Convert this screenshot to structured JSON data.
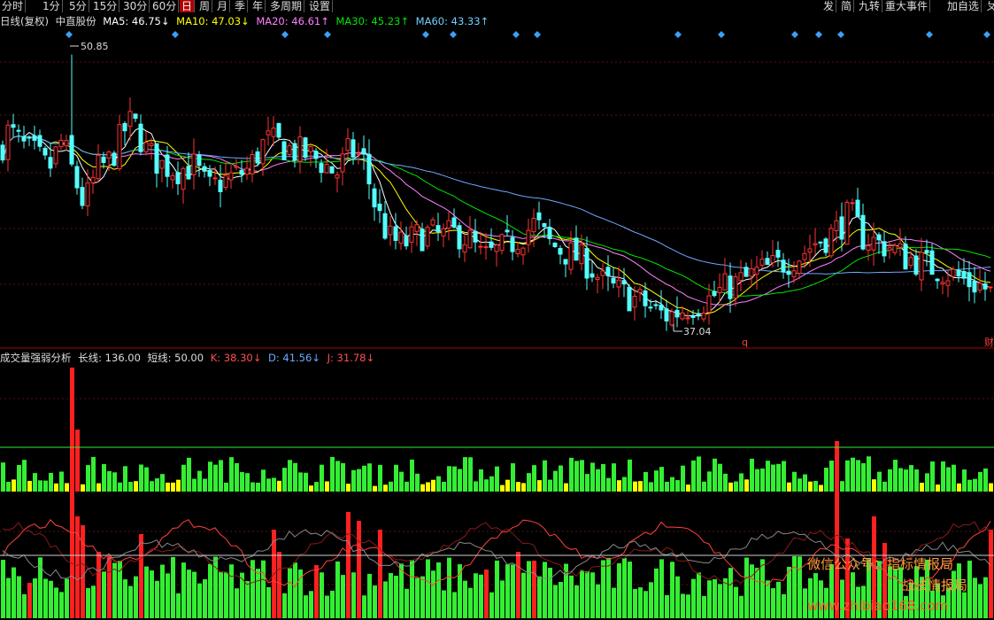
{
  "toolbar": {
    "left_buttons": [
      "分时",
      "1分",
      "5分",
      "15分",
      "30分",
      "60分",
      "日",
      "周",
      "月",
      "季",
      "年",
      "多周期",
      "设置"
    ],
    "active": "日",
    "right_buttons": [
      "发",
      "简",
      "九转",
      "重大事件",
      "加自选",
      "ㄆ"
    ]
  },
  "header": {
    "period": "日线(复权)",
    "stock": "中直股份",
    "ma5": "MA5: 46.75↓",
    "ma10": "MA10: 47.03↓",
    "ma20": "MA20: 46.61↑",
    "ma30": "MA30: 45.23↑",
    "ma60": "MA60: 43.33↑"
  },
  "annotations": {
    "high": "50.85",
    "low": "37.04",
    "marker_q": "q",
    "marker_right": "财"
  },
  "indicator": {
    "name": "成交量强弱分析",
    "long": "长线: 136.00",
    "short": "短线: 50.00",
    "k": "K: 38.30↓",
    "d": "D: 41.56↓",
    "j": "J: 31.78↓"
  },
  "watermark": {
    "line1": "微信公众号：指标情报局",
    "line2": "战法情报局",
    "line3": "www.zhibiao168.com"
  },
  "colors": {
    "up": "#ff3232",
    "down": "#54ffff",
    "ma5": "#ffffff",
    "ma10": "#ffff00",
    "ma20": "#ff80ff",
    "ma30": "#00e600",
    "ma60": "#6fa8ff",
    "vol_green": "#33ee33",
    "vol_yellow": "#ffff00",
    "vol_red": "#ff2020"
  },
  "chart_data": {
    "type": "candlestick",
    "high": 50.85,
    "low": 37.04,
    "ylim": [
      36,
      52
    ],
    "long_line": 136.0,
    "short_line": 50.0
  }
}
